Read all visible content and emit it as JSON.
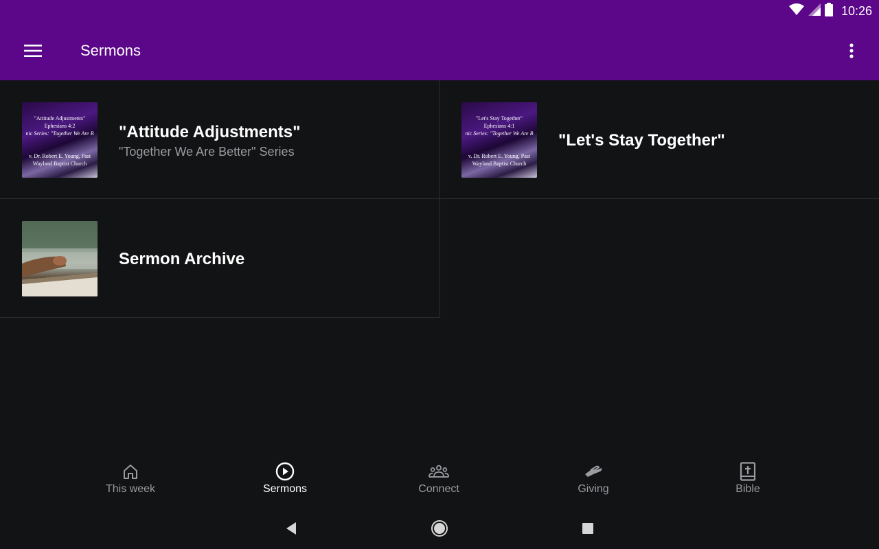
{
  "status_bar": {
    "time": "10:26",
    "icons": [
      "wifi-icon",
      "signal-icon",
      "battery-icon"
    ]
  },
  "app_bar": {
    "title": "Sermons",
    "menu_icon": "hamburger-menu-icon",
    "more_icon": "more-vert-icon",
    "color": "#5c0789"
  },
  "sermons": [
    {
      "title": "\"Attitude Adjustments\"",
      "subtitle": "\"Together We Are Better\" Series",
      "thumb_lines": [
        "\"Attitude Adjustments\"",
        "Ephesians 4:2",
        "nic Series: \"Together We Are B",
        "",
        "v. Dr. Robert E. Young, Past",
        "Wayland Baptist Church"
      ]
    },
    {
      "title": "\"Let's Stay Together\"",
      "subtitle": "",
      "thumb_lines": [
        "\"Let's Stay Together\"",
        "Ephesians 4:1",
        "nic Series: \"Together We Are B",
        "",
        "v. Dr. Robert E. Young, Past",
        "Wayland Baptist Church"
      ]
    },
    {
      "title": "Sermon Archive",
      "subtitle": "",
      "thumb_lines": []
    }
  ],
  "bottom_nav": [
    {
      "label": "This week",
      "icon": "home-icon",
      "active": false
    },
    {
      "label": "Sermons",
      "icon": "play-circle-icon",
      "active": true
    },
    {
      "label": "Connect",
      "icon": "people-group-icon",
      "active": false
    },
    {
      "label": "Giving",
      "icon": "giving-hand-icon",
      "active": false
    },
    {
      "label": "Bible",
      "icon": "bible-icon",
      "active": false
    }
  ],
  "system_nav": [
    "back-icon",
    "home-circle-icon",
    "recents-icon"
  ]
}
